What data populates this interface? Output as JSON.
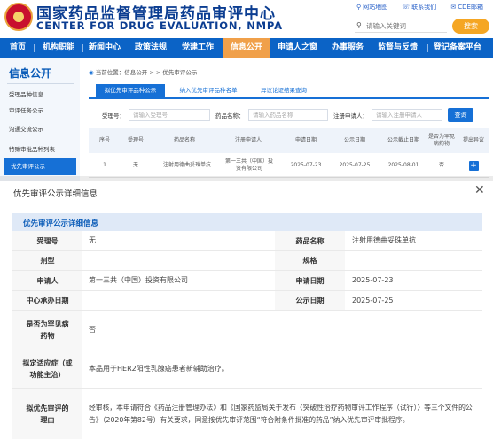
{
  "header": {
    "title": "国家药品监督管理局药品审评中心",
    "subtitle": "CENTER FOR DRUG EVALUATION, NMPA",
    "links": [
      "网站地图",
      "联系我们",
      "CDE邮箱"
    ],
    "search_placeholder": "请输入关键词",
    "search_button": "搜索"
  },
  "nav": [
    "首页",
    "机构职能",
    "新闻中心",
    "政策法规",
    "党建工作",
    "信息公开",
    "申请人之窗",
    "办事服务",
    "监督与反馈",
    "登记备案平台"
  ],
  "sidebar": {
    "title": "信息公开",
    "items": [
      "受理品种信息",
      "审评任务公示",
      "沟通交流公示",
      "特殊审批品种列表",
      "优先审评公示"
    ]
  },
  "breadcrumb": "当前位置：信息公开 > > 优先审评公示",
  "tabs": [
    "拟优先审评品种公示",
    "纳入优先审评品种名单",
    "异议论证结果查询"
  ],
  "filter": {
    "acceptance_label": "受理号：",
    "acceptance_placeholder": "请输入受理号",
    "drug_label": "药品名称：",
    "drug_placeholder": "请输入药品名称",
    "applicant_label": "注册申请人：",
    "applicant_placeholder": "请输入注册申请人",
    "query_button": "查询"
  },
  "table": {
    "headers": [
      "序号",
      "受理号",
      "药品名称",
      "注册申请人",
      "申请日期",
      "公示日期",
      "公示截止日期",
      "是否为罕见病药物",
      "提出异议"
    ],
    "rows": [
      [
        "1",
        "无",
        "注射用德曲妥珠单抗",
        "第一三共（中国）投资有限公司",
        "2025-07-23",
        "2025-07-25",
        "2025-08-01",
        "否",
        "+"
      ]
    ]
  },
  "modal": {
    "title": "优先审评公示详细信息",
    "close": "✕",
    "section_title": "优先审评公示详细信息",
    "fields": {
      "acceptance_label": "受理号",
      "acceptance_value": "无",
      "drug_label": "药品名称",
      "drug_value": "注射用德曲妥珠单抗",
      "dosage_label": "剂型",
      "dosage_value": "",
      "spec_label": "规格",
      "spec_value": "",
      "applicant_label": "申请人",
      "applicant_value": "第一三共（中国）投资有限公司",
      "apply_date_label": "申请日期",
      "apply_date_value": "2025-07-23",
      "dept_label": "中心承办日期",
      "dept_value": "",
      "publish_date_label": "公示日期",
      "publish_date_value": "2025-07-25",
      "rare_label": "是否为罕见病药物",
      "rare_value": "否",
      "indication_label": "拟定适应症（或功能主治）",
      "indication_value": "本品用于HER2阳性乳腺癌患者新辅助治疗。",
      "reason_label": "拟优先审评的理由",
      "reason_value": "经审核，本申请符合《药品注册管理办法》和《国家药监局关于发布〈突破性治疗药物审评工作程序（试行）〉等三个文件的公告》（2020年第82号）有关要求，同意按优先审评范围“符合附条件批准的药品”纳入优先审评审批程序。"
    }
  }
}
